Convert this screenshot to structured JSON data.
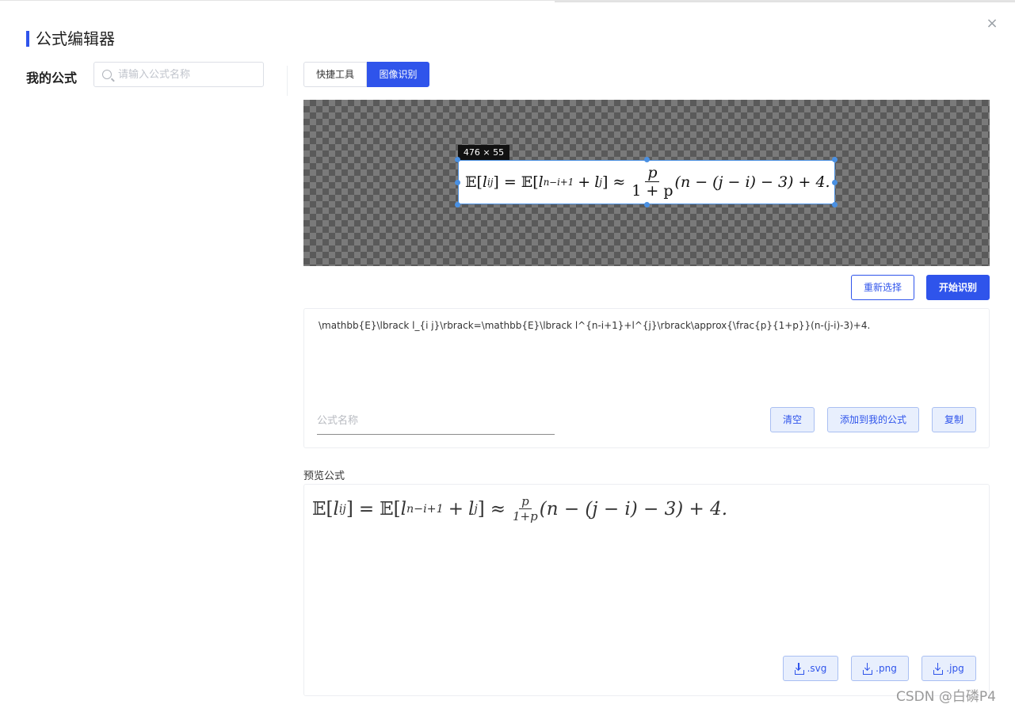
{
  "dialog": {
    "title": "公式编辑器",
    "close_label": "×"
  },
  "sidebar": {
    "label": "我的公式",
    "search_placeholder": "请输入公式名称"
  },
  "tabs": [
    {
      "label": "快捷工具",
      "active": false
    },
    {
      "label": "图像识别",
      "active": true
    }
  ],
  "image_recognition": {
    "crop_size_label": "476 × 55",
    "formula_parts": {
      "lhs_bb": "𝔼",
      "lhs_var": "l",
      "lhs_sub": "ij",
      "eq": "=",
      "rhs_bb": "𝔼",
      "base1": "l",
      "exp1": "n−i+1",
      "plus": "+",
      "base2": "l",
      "exp2": "j",
      "approx": "≈",
      "frac_num": "p",
      "frac_den": "1 + p",
      "tail": "(n − (j − i) − 3) + 4."
    },
    "reselect_label": "重新选择",
    "start_label": "开始识别"
  },
  "latex_editor": {
    "value": "\\mathbb{E}\\lbrack l_{i j}\\rbrack=\\mathbb{E}\\lbrack l^{n-i+1}+l^{j}\\rbrack\\approx{\\frac{p}{1+p}}(n-(j-i)-3)+4.",
    "name_placeholder": "公式名称",
    "clear_label": "清空",
    "add_label": "添加到我的公式",
    "copy_label": "复制"
  },
  "preview": {
    "label": "预览公式",
    "formula_parts": {
      "lhs_bb": "𝔼",
      "lhs_var": "l",
      "lhs_sub": "ij",
      "eq": "=",
      "rhs_bb": "𝔼",
      "base1": "l",
      "exp1": "n−i+1",
      "plus": "+",
      "base2": "l",
      "exp2": "j",
      "approx": "≈",
      "frac_num": "p",
      "frac_den": "1+p",
      "tail": "(n − (j − i) − 3) + 4."
    },
    "downloads": [
      ".svg",
      ".png",
      ".jpg"
    ]
  },
  "watermark": "CSDN @白磷P4",
  "colors": {
    "accent": "#2f54eb",
    "soft_button_bg": "#e8effd",
    "handle": "#4a90e2"
  }
}
